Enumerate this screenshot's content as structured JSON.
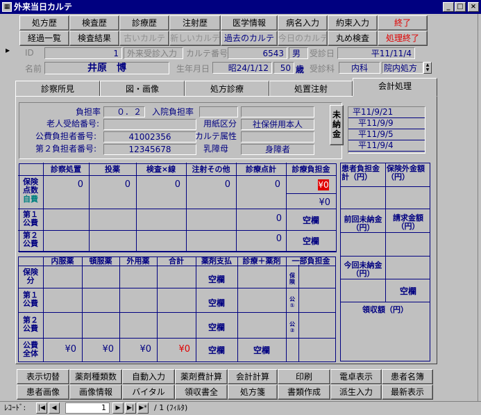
{
  "window": {
    "title": "外来当日カルテ",
    "icon": "grid-icon"
  },
  "toolbar_row1": [
    {
      "label": "処方歴",
      "style": ""
    },
    {
      "label": "検査歴",
      "style": ""
    },
    {
      "label": "診療歴",
      "style": ""
    },
    {
      "label": "注射歴",
      "style": ""
    },
    {
      "label": "医学情報",
      "style": ""
    },
    {
      "label": "病名入力",
      "style": ""
    },
    {
      "label": "約束入力",
      "style": ""
    },
    {
      "label": "終了",
      "style": "red"
    }
  ],
  "toolbar_row2": [
    {
      "label": "経過一覧",
      "style": ""
    },
    {
      "label": "検査結果",
      "style": ""
    },
    {
      "label": "古いカルテ",
      "style": "gray"
    },
    {
      "label": "新しいカルテ",
      "style": "gray"
    },
    {
      "label": "過去のカルテ",
      "style": "dblue"
    },
    {
      "label": "今日のカルテ",
      "style": "gray"
    },
    {
      "label": "丸め検査",
      "style": ""
    },
    {
      "label": "処理終了",
      "style": "red"
    }
  ],
  "patient": {
    "id_label": "ID",
    "id_value": "1",
    "visit_type": "外来受診入力",
    "chart_label": "カルテ番号",
    "chart_value": "6543",
    "sex": "男",
    "visit_date_label": "受診日",
    "visit_date": "平11/11/4",
    "name_label": "名前",
    "name_value": "井原　博",
    "birth_label": "生年月日",
    "birth_value": "昭24/1/12",
    "age": "50",
    "age_unit": "歳",
    "dept_label": "受診科",
    "dept_value": "内科",
    "prescription": "院内処方"
  },
  "tabs": [
    "診察所見",
    "図・画像",
    "処方診療",
    "処置注射",
    "会計処理"
  ],
  "active_tab": 4,
  "billing": {
    "burden_rate_label": "負担率",
    "burden_rate": "０．２",
    "inpatient_rate_label": "入院負担率",
    "elderly_label": "老人受給番号:",
    "public_payer_label": "公費負担者番号:",
    "public_payer": "41002356",
    "second_payer_label": "第２負担者番号:",
    "second_payer": "12345678",
    "paper_label": "用紙区分",
    "paper_value": "社保併用本人",
    "chart_attr_label": "カルテ属性",
    "infant_label": "乳障母",
    "infant_value": "身障者",
    "unpaid_label": "未納金",
    "unpaid_dates": [
      "平11/9/21",
      "平11/9/9",
      "平11/9/5",
      "平11/9/4"
    ]
  },
  "table1": {
    "headers": [
      "診察処置",
      "投薬",
      "検査×線",
      "注射その他",
      "診療点計",
      "診療負担金"
    ],
    "row_insurance": "保険点数",
    "self_pay": "自費",
    "row_pub1": "第１公費",
    "row_pub2": "第２公費",
    "ins_values": [
      "0",
      "0",
      "0",
      "0",
      "0"
    ],
    "burden_value": "¥0",
    "self_value": "¥0",
    "pub1_points": "0",
    "pub1_burden": "空欄",
    "pub2_points": "0",
    "pub2_burden": "空欄"
  },
  "table2": {
    "headers": [
      "内服薬",
      "頓服薬",
      "外用薬",
      "合計",
      "薬剤支払",
      "診療＋薬剤",
      "一部負担金"
    ],
    "row_ins": "保険分",
    "row_pub1": "第１公費",
    "row_pub2": "第２公費",
    "row_total": "公費全体",
    "side_ins": "保険",
    "side_pub1": "公①",
    "side_pub2": "公②",
    "ins_pay": "空欄",
    "pub1_pay": "空欄",
    "pub2_pay": "空欄",
    "total_values": [
      "¥0",
      "¥0",
      "¥0",
      "¥0"
    ],
    "total_pay": "空欄",
    "total_plus": "空欄"
  },
  "summary": {
    "patient_burden": "患者負担金計（円）",
    "noninsured": "保険外金額（円）",
    "prev_unpaid": "前回未納金（円）",
    "billing_amount": "請求金額（円）",
    "today_unpaid": "今回未納金（円）",
    "today_value": "空欄",
    "received": "領収額（円）"
  },
  "bottom_row1": [
    "表示切替",
    "薬剤種類数",
    "自動入力",
    "薬剤費計算",
    "会計計算",
    "印刷",
    "電卓表示",
    "患者名簿"
  ],
  "bottom_row2": [
    "患者画像",
    "画像情報",
    "バイタル",
    "領収書全",
    "処方箋",
    "書類作成",
    "派生入力",
    "最新表示"
  ],
  "status": {
    "record_label": "ﾚｺｰﾄﾞ:",
    "record_value": "1",
    "total": "/ 1 (ﾌｨﾙﾀ)"
  },
  "colors": {
    "accent": "#000080",
    "alert": "#e00000",
    "face": "#c0c0c0"
  }
}
